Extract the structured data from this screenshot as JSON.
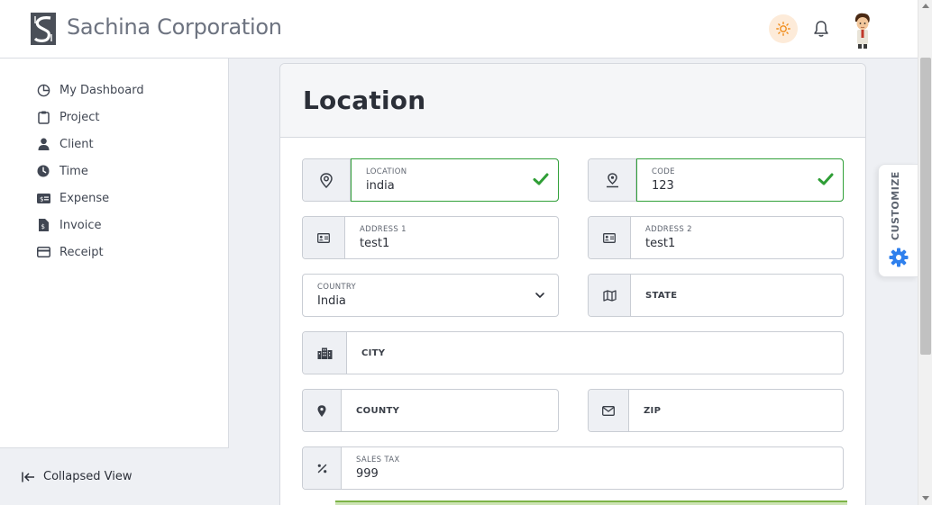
{
  "header": {
    "brand": "Sachina Corporation",
    "icons": [
      "logo",
      "sun-icon",
      "bell-icon",
      "avatar"
    ]
  },
  "sidebar": {
    "items": [
      {
        "label": "My Dashboard",
        "icon": "pie-chart-icon"
      },
      {
        "label": "Project",
        "icon": "clipboard-icon"
      },
      {
        "label": "Client",
        "icon": "user-icon"
      },
      {
        "label": "Time",
        "icon": "clock-icon"
      },
      {
        "label": "Expense",
        "icon": "money-icon"
      },
      {
        "label": "Invoice",
        "icon": "invoice-icon"
      },
      {
        "label": "Receipt",
        "icon": "receipt-icon"
      }
    ],
    "collapse_label": "Collapsed View"
  },
  "form": {
    "title": "Location",
    "location": {
      "label": "LOCATION",
      "value": "india"
    },
    "code": {
      "label": "CODE",
      "value": "123"
    },
    "address1": {
      "label": "ADDRESS 1",
      "value": "test1"
    },
    "address2": {
      "label": "ADDRESS 2",
      "value": "test1"
    },
    "country": {
      "label": "COUNTRY",
      "value": "India"
    },
    "state": {
      "label": "STATE"
    },
    "city": {
      "label": "CITY"
    },
    "county": {
      "label": "COUNTY"
    },
    "zip": {
      "label": "ZIP"
    },
    "sales_tax": {
      "label": "SALES TAX",
      "value": "999"
    }
  },
  "customize": {
    "label": "CUSTOMIZE"
  },
  "colors": {
    "accent": "#2f80ed",
    "valid": "#32a13a",
    "sun_bg": "#fdebd9"
  }
}
